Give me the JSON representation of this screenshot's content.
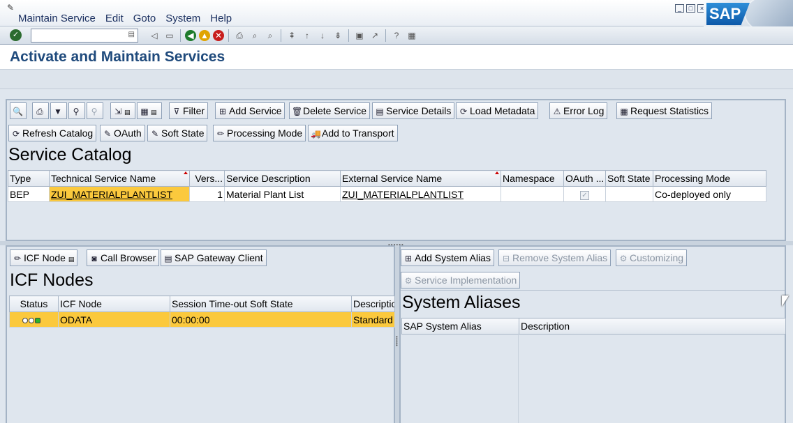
{
  "menu": {
    "items": [
      "Maintain Service",
      "Edit",
      "Goto",
      "System",
      "Help"
    ]
  },
  "brand": {
    "logo_text": "SAP"
  },
  "title": "Activate and Maintain Services",
  "toolbar": {
    "filter": "Filter",
    "add_service": "Add Service",
    "delete_service": "Delete Service",
    "service_details": "Service Details",
    "load_metadata": "Load Metadata",
    "error_log": "Error Log",
    "request_statistics": "Request Statistics",
    "refresh_catalog": "Refresh Catalog",
    "oauth": "OAuth",
    "soft_state": "Soft State",
    "processing_mode": "Processing Mode",
    "add_to_transport": "Add to Transport"
  },
  "service_catalog": {
    "heading": "Service Catalog",
    "columns": [
      "Type",
      "Technical Service Name",
      "Vers...",
      "Service Description",
      "External Service Name",
      "Namespace",
      "OAuth ...",
      "Soft State",
      "Processing Mode"
    ],
    "rows": [
      {
        "type": "BEP",
        "technical_name": "ZUI_MATERIALPLANTLIST",
        "version": "1",
        "description": "Material Plant List",
        "external_name": "ZUI_MATERIALPLANTLIST",
        "namespace": "",
        "oauth": true,
        "soft_state": "",
        "processing_mode": "Co-deployed only"
      }
    ]
  },
  "icf": {
    "buttons": {
      "icf_node": "ICF Node",
      "call_browser": "Call Browser",
      "gateway_client": "SAP Gateway Client"
    },
    "heading": "ICF Nodes",
    "columns": [
      "Status",
      "ICF Node",
      "Session Time-out Soft State",
      "Description"
    ],
    "rows": [
      {
        "status": "green",
        "node": "ODATA",
        "timeout": "00:00:00",
        "description": "Standard"
      }
    ]
  },
  "aliases": {
    "buttons": {
      "add": "Add System Alias",
      "remove": "Remove System Alias",
      "customizing": "Customizing",
      "service_impl": "Service Implementation"
    },
    "heading": "System Aliases",
    "columns": [
      "SAP System Alias",
      "Description"
    ]
  }
}
